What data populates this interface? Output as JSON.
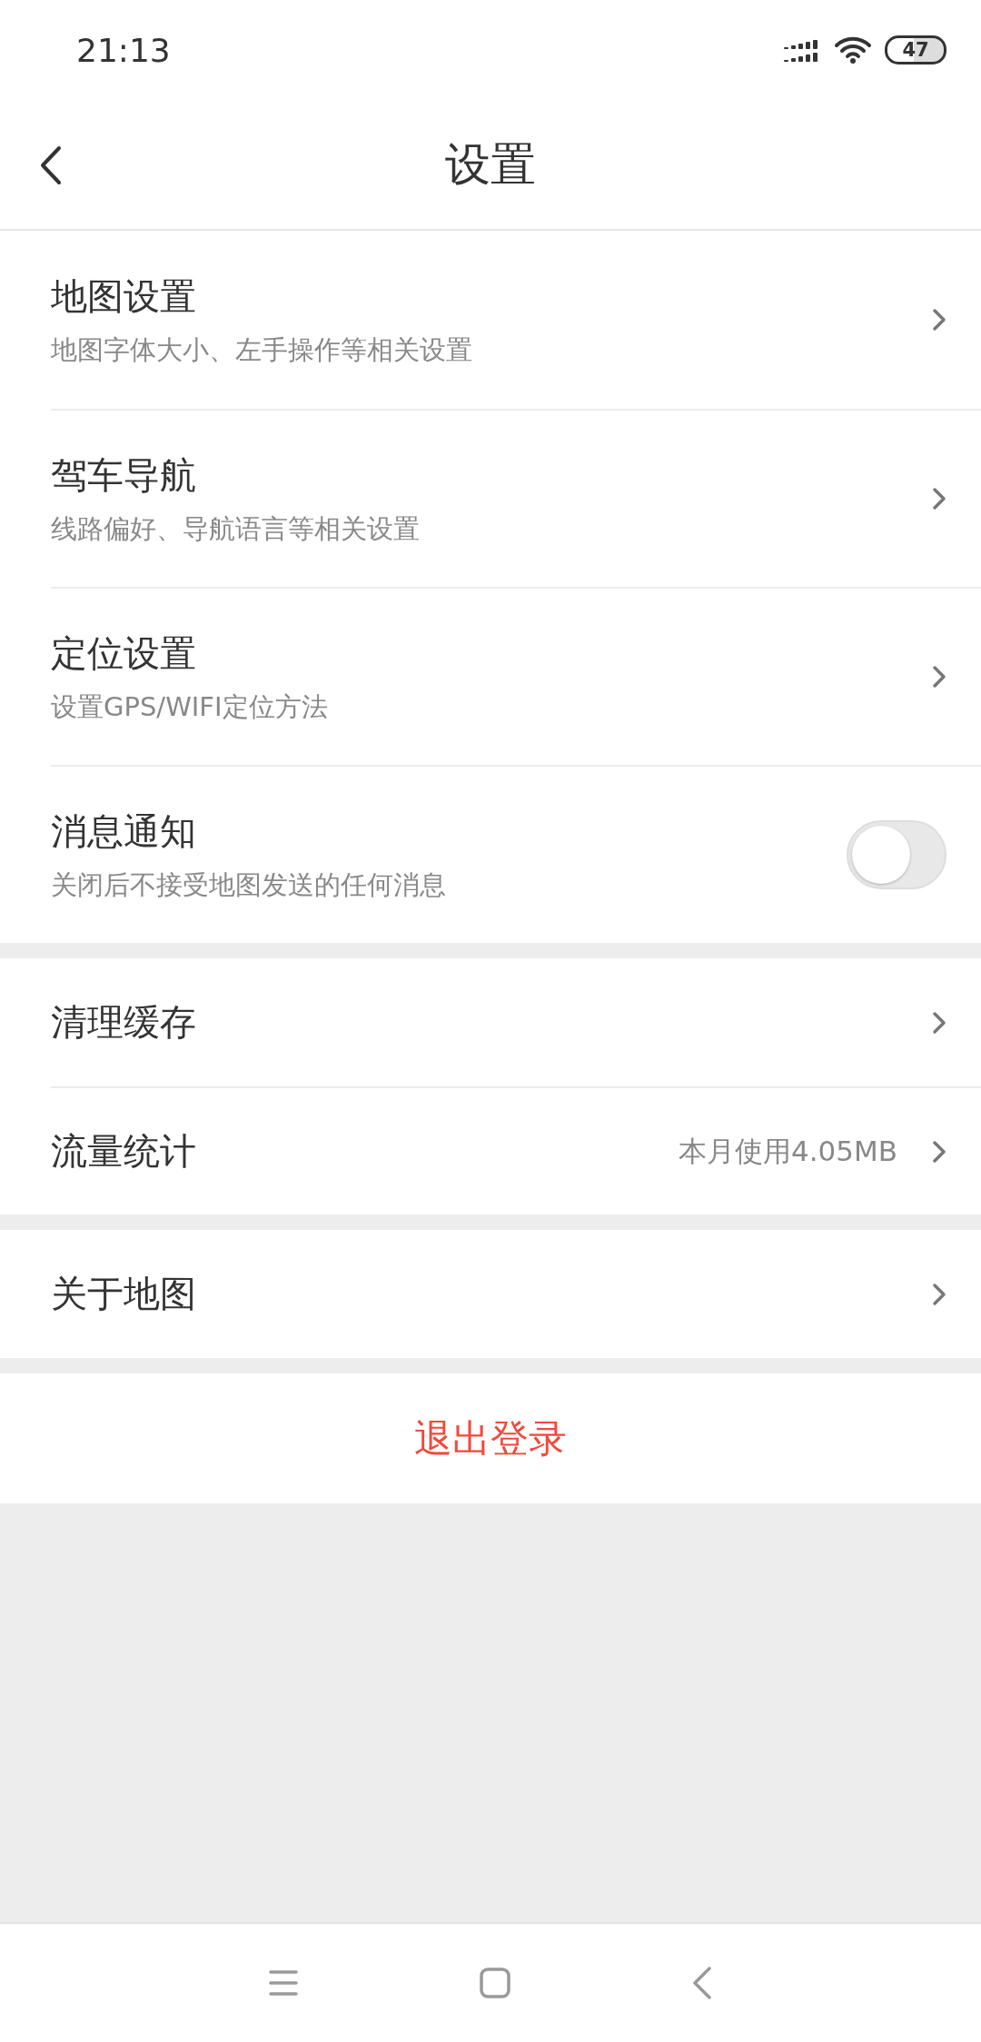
{
  "status_bar": {
    "time": "21:13",
    "battery": "47"
  },
  "header": {
    "title": "设置"
  },
  "sections": [
    {
      "items": [
        {
          "kind": "link",
          "title": "地图设置",
          "subtitle": "地图字体大小、左手操作等相关设置"
        },
        {
          "kind": "link",
          "title": "驾车导航",
          "subtitle": "线路偏好、导航语言等相关设置"
        },
        {
          "kind": "link",
          "title": "定位设置",
          "subtitle": "设置GPS/WIFI定位方法"
        },
        {
          "kind": "toggle",
          "title": "消息通知",
          "subtitle": "关闭后不接受地图发送的任何消息",
          "on": false
        }
      ]
    },
    {
      "items": [
        {
          "kind": "link",
          "title": "清理缓存"
        },
        {
          "kind": "link",
          "title": "流量统计",
          "value": "本月使用4.05MB"
        }
      ]
    },
    {
      "items": [
        {
          "kind": "link",
          "title": "关于地图"
        }
      ]
    }
  ],
  "logout": {
    "label": "退出登录"
  }
}
